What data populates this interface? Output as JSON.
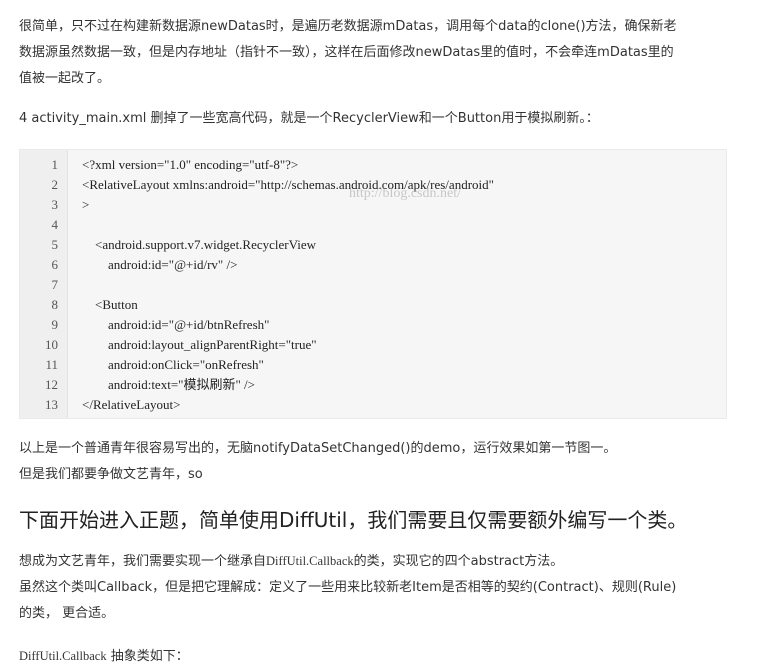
{
  "article": {
    "intro_lines": [
      "很简单，只不过在构建新数据源newDatas时，是遍历老数据源mDatas，调用每个data的clone()方法，确保新老",
      "数据源虽然数据一致，但是内存地址（指针不一致），这样在后面修改newDatas里的值时，不会牵连mDatas里的",
      "值被一起改了。"
    ],
    "step4": "4 activity_main.xml 删掉了一些宽高代码，就是一个RecyclerView和一个Button用于模拟刷新。：",
    "code": {
      "line_numbers": [
        "1",
        "2",
        "3",
        "4",
        "5",
        "6",
        "7",
        "8",
        "9",
        "10",
        "11",
        "12",
        "13"
      ],
      "lines": [
        "<?xml version=\"1.0\" encoding=\"utf-8\"?>",
        "<RelativeLayout xmlns:android=\"http://schemas.android.com/apk/res/android\"",
        ">",
        "",
        "    <android.support.v7.widget.RecyclerView",
        "        android:id=\"@+id/rv\" />",
        "",
        "    <Button",
        "        android:id=\"@+id/btnRefresh\"",
        "        android:layout_alignParentRight=\"true\"",
        "        android:onClick=\"onRefresh\"",
        "        android:text=\"模拟刷新\" />",
        "</RelativeLayout>"
      ],
      "watermark": "http://blog.csdn.net/"
    },
    "after_code_lines": [
      "以上是一个普通青年很容易写出的，无脑notifyDataSetChanged()的demo，运行效果如第一节图一。",
      "但是我们都要争做文艺青年，so"
    ],
    "heading": "下面开始进入正题，简单使用DiffUtil，我们需要且仅需要额外编写一个类。",
    "para_a_prefix": "想成为文艺青年，我们需要实现一个继承自",
    "para_a_code": "DiffUtil.Callback",
    "para_a_suffix": "的类，实现它的四个abstract方法。",
    "para_b_lines": [
      "虽然这个类叫Callback，但是把它理解成：定义了一些用来比较新老Item是否相等的契约(Contract)、规则(Rule)",
      "的类， 更合适。"
    ],
    "last_code": "DiffUtil.Callback",
    "last_suffix": " 抽象类如下："
  }
}
